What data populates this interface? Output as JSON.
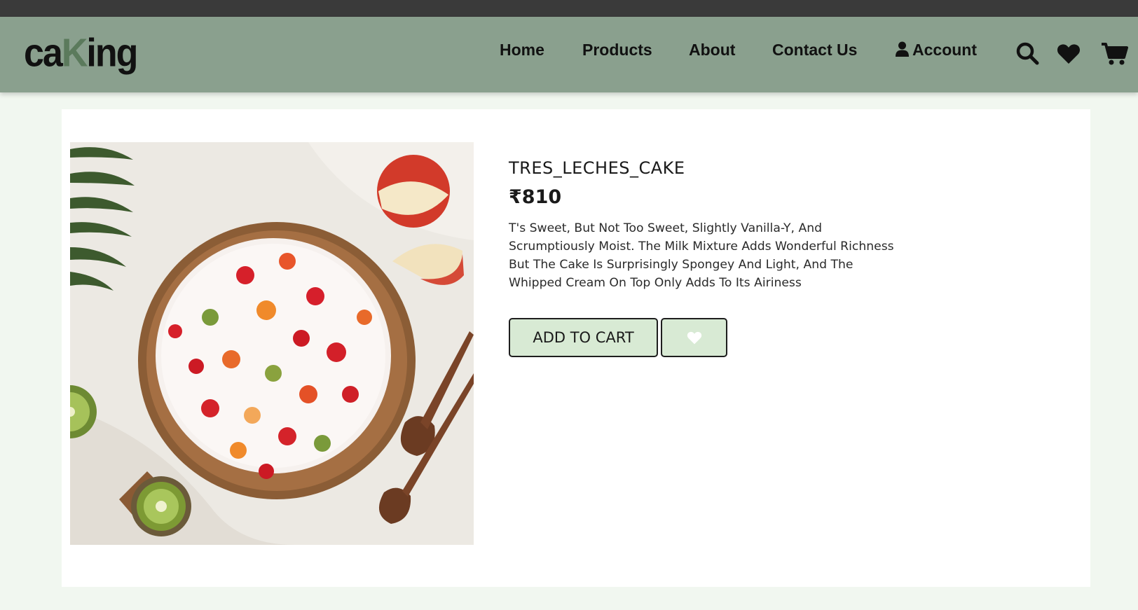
{
  "brand": {
    "logo_before": "ca",
    "logo_accent": "K",
    "logo_after": "ing"
  },
  "nav": {
    "home": "Home",
    "products": "Products",
    "about": "About",
    "contact": "Contact Us",
    "account": "Account"
  },
  "icons": {
    "user": "user-icon",
    "search": "search-icon",
    "wishlist": "heart-icon",
    "cart": "cart-icon"
  },
  "product": {
    "name": "TRES_LECHES_CAKE",
    "price": "₹810",
    "description": "T's Sweet, But Not Too Sweet, Slightly Vanilla-Y, And Scrumptiously Moist. The Milk Mixture Adds Wonderful Richness But The Cake Is Surprisingly Spongey And Light, And The Whipped Cream On Top Only Adds To Its Airiness",
    "add_to_cart_label": "ADD TO CART"
  },
  "colors": {
    "topbar": "#3a3a3a",
    "navbar": "#8aa08e",
    "page_bg": "#f1f7f0",
    "button_bg": "#d8ead4",
    "logo_accent": "#5b7a5c"
  }
}
